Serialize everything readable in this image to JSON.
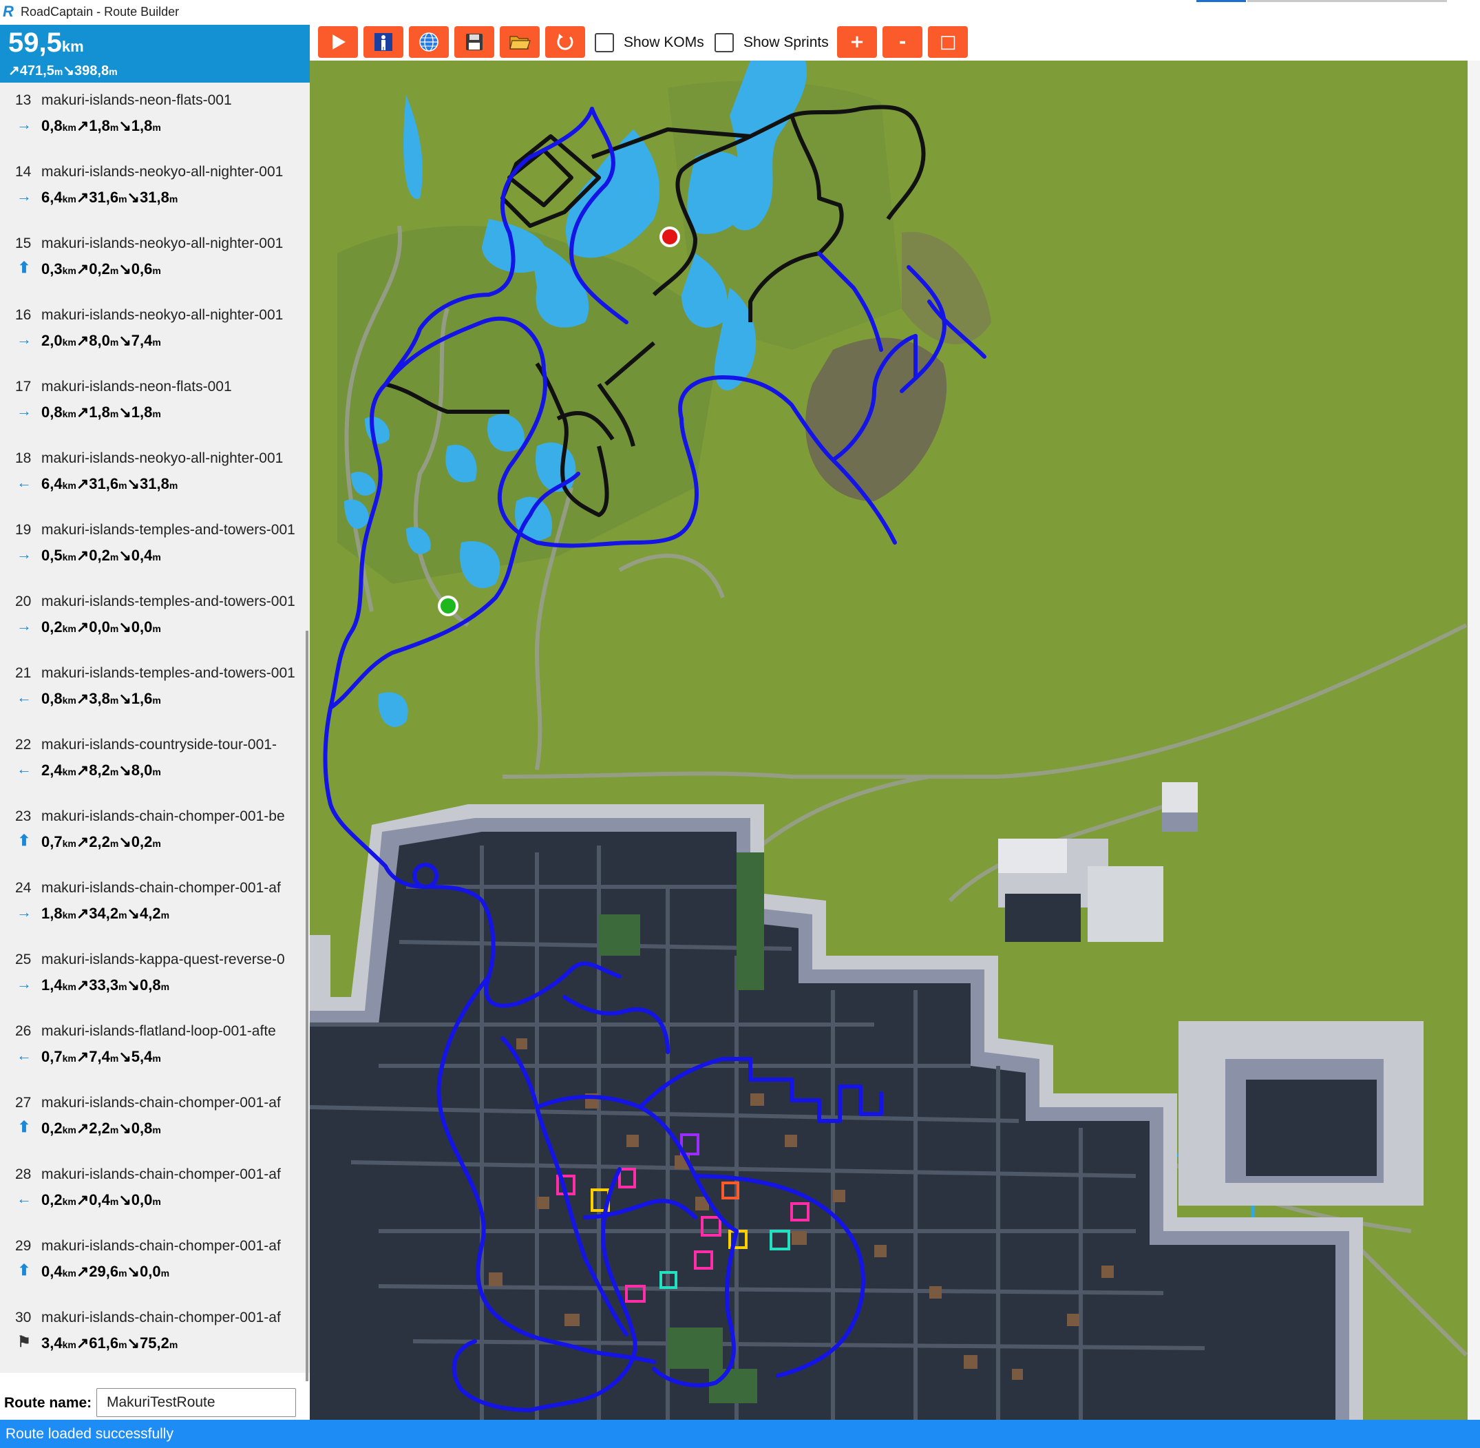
{
  "window": {
    "title": "RoadCaptain - Route Builder",
    "logo_letter": "R"
  },
  "summary": {
    "distance": "59,5",
    "distance_unit": "km",
    "ascent": "471,5",
    "descent": "398,8",
    "elev_unit": "m"
  },
  "toolbar": {
    "buttons": [
      "play-icon",
      "simulate-rider-icon",
      "select-world-icon",
      "save-icon",
      "open-folder-icon",
      "reset-icon"
    ],
    "show_koms_label": "Show KOMs",
    "show_sprints_label": "Show Sprints",
    "zoom_in_label": "+",
    "zoom_out_label": "-",
    "reset_zoom_label": "□",
    "accent_color": "#fb5a2a"
  },
  "segments": [
    {
      "index": "13",
      "name": "makuri-islands-neon-flats-001",
      "direction": "right-arrow-icon",
      "km": "0,8",
      "up": "1,8",
      "down": "1,8"
    },
    {
      "index": "14",
      "name": "makuri-islands-neokyo-all-nighter-001",
      "direction": "right-arrow-icon",
      "km": "6,4",
      "up": "31,6",
      "down": "31,8"
    },
    {
      "index": "15",
      "name": "makuri-islands-neokyo-all-nighter-001",
      "direction": "up-arrow-icon",
      "km": "0,3",
      "up": "0,2",
      "down": "0,6"
    },
    {
      "index": "16",
      "name": "makuri-islands-neokyo-all-nighter-001",
      "direction": "right-arrow-icon",
      "km": "2,0",
      "up": "8,0",
      "down": "7,4"
    },
    {
      "index": "17",
      "name": "makuri-islands-neon-flats-001",
      "direction": "right-arrow-icon",
      "km": "0,8",
      "up": "1,8",
      "down": "1,8"
    },
    {
      "index": "18",
      "name": "makuri-islands-neokyo-all-nighter-001",
      "direction": "left-arrow-icon",
      "km": "6,4",
      "up": "31,6",
      "down": "31,8"
    },
    {
      "index": "19",
      "name": "makuri-islands-temples-and-towers-001",
      "direction": "right-arrow-icon",
      "km": "0,5",
      "up": "0,2",
      "down": "0,4"
    },
    {
      "index": "20",
      "name": "makuri-islands-temples-and-towers-001",
      "direction": "right-arrow-icon",
      "km": "0,2",
      "up": "0,0",
      "down": "0,0"
    },
    {
      "index": "21",
      "name": "makuri-islands-temples-and-towers-001",
      "direction": "left-arrow-icon",
      "km": "0,8",
      "up": "3,8",
      "down": "1,6"
    },
    {
      "index": "22",
      "name": "makuri-islands-countryside-tour-001-",
      "direction": "left-arrow-icon",
      "km": "2,4",
      "up": "8,2",
      "down": "8,0"
    },
    {
      "index": "23",
      "name": "makuri-islands-chain-chomper-001-be",
      "direction": "up-arrow-icon",
      "km": "0,7",
      "up": "2,2",
      "down": "0,2"
    },
    {
      "index": "24",
      "name": "makuri-islands-chain-chomper-001-af",
      "direction": "right-arrow-icon",
      "km": "1,8",
      "up": "34,2",
      "down": "4,2"
    },
    {
      "index": "25",
      "name": "makuri-islands-kappa-quest-reverse-0",
      "direction": "right-arrow-icon",
      "km": "1,4",
      "up": "33,3",
      "down": "0,8"
    },
    {
      "index": "26",
      "name": "makuri-islands-flatland-loop-001-afte",
      "direction": "left-arrow-icon",
      "km": "0,7",
      "up": "7,4",
      "down": "5,4"
    },
    {
      "index": "27",
      "name": "makuri-islands-chain-chomper-001-af",
      "direction": "up-arrow-icon",
      "km": "0,2",
      "up": "2,2",
      "down": "0,8"
    },
    {
      "index": "28",
      "name": "makuri-islands-chain-chomper-001-af",
      "direction": "left-arrow-icon",
      "km": "0,2",
      "up": "0,4",
      "down": "0,0"
    },
    {
      "index": "29",
      "name": "makuri-islands-chain-chomper-001-af",
      "direction": "up-arrow-icon",
      "km": "0,4",
      "up": "29,6",
      "down": "0,0"
    },
    {
      "index": "30",
      "name": "makuri-islands-chain-chomper-001-af",
      "direction": "finish-flag-icon",
      "km": "3,4",
      "up": "61,6",
      "down": "75,2"
    }
  ],
  "route_name": {
    "label": "Route name:",
    "value": "MakuriTestRoute"
  },
  "status": {
    "message": "Route loaded successfully"
  },
  "map": {
    "colors": {
      "grass": "#7e9c37",
      "water": "#2fa8e6",
      "city": "#2b3240",
      "route": "#1414e6",
      "alt_route": "#111111",
      "start_marker": "#1db81d",
      "end_marker": "#e51414"
    }
  }
}
